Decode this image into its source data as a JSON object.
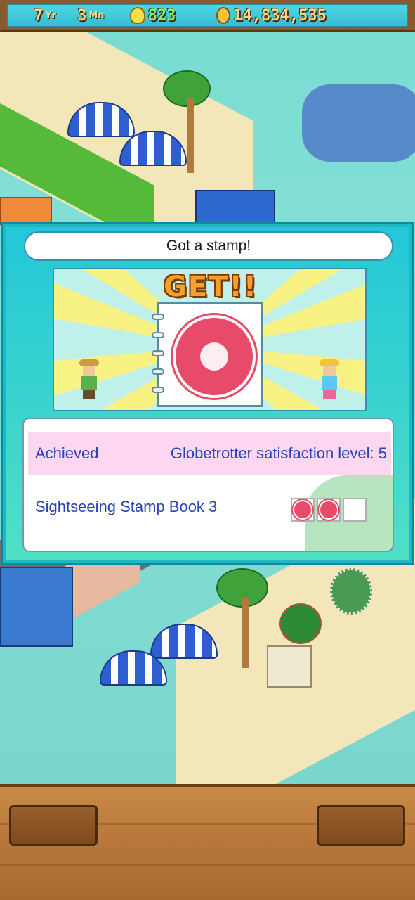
{
  "status_bar": {
    "year_value": "7",
    "year_unit": "Yr",
    "month_value": "3",
    "month_unit": "Mn",
    "research_icon": "lightbulb-icon",
    "research_points": "823",
    "money_icon": "coin-icon",
    "money": "14,834,535"
  },
  "dialog": {
    "title": "Got a stamp!",
    "banner_text": "GET!!",
    "stamp_icon": "hibiscus-stamp-icon",
    "achieved_label": "Achieved",
    "achievement_text": "Globetrotter satisfaction level: 5",
    "stamp_book_label": "Sightseeing Stamp Book 3",
    "stamp_slots": [
      {
        "filled": true,
        "icon": "hibiscus-stamp-icon"
      },
      {
        "filled": true,
        "icon": "hibiscus-stamp-icon"
      },
      {
        "filled": false,
        "icon": ""
      }
    ]
  },
  "colors": {
    "dialog_frame": "#1fb7c4",
    "achieved_row": "#fdd6ef",
    "info_text": "#2744b8",
    "stamp_red": "#e84a6a"
  },
  "bottom_bar": {
    "left_button_icon": "wood-button",
    "right_button_icon": "wood-button"
  }
}
